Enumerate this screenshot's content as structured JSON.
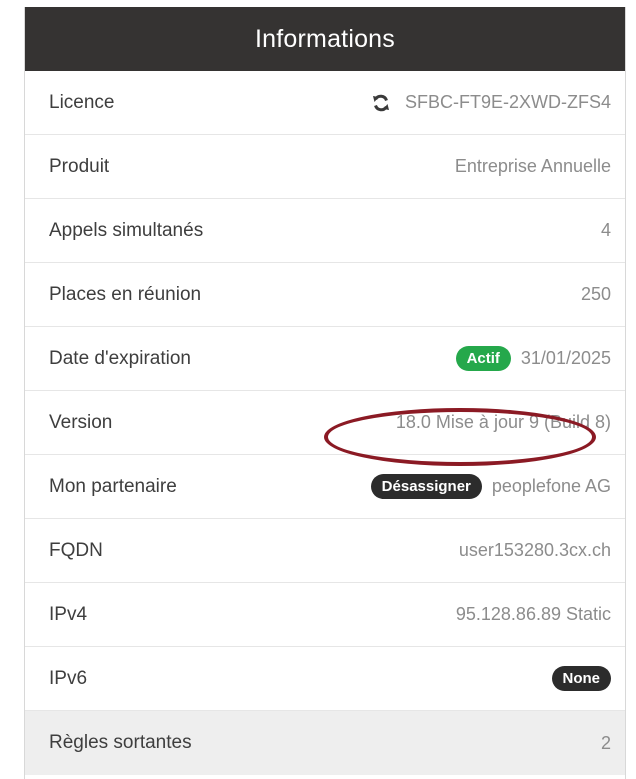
{
  "header": {
    "title": "Informations"
  },
  "rows": [
    {
      "label": "Licence",
      "value": "SFBC-FT9E-2XWD-ZFS4",
      "icon": "refresh-icon"
    },
    {
      "label": "Produit",
      "value": "Entreprise Annuelle"
    },
    {
      "label": "Appels simultanés",
      "value": "4"
    },
    {
      "label": "Places en réunion",
      "value": "250"
    },
    {
      "label": "Date d'expiration",
      "badge": "Actif",
      "value": "31/01/2025"
    },
    {
      "label": "Version",
      "value": "18.0 Mise à jour 9 (Build 8)"
    },
    {
      "label": "Mon partenaire",
      "badge": "Désassigner",
      "value": "peoplefone AG"
    },
    {
      "label": "FQDN",
      "value": "user153280.3cx.ch"
    },
    {
      "label": "IPv4",
      "value": "95.128.86.89 Static"
    },
    {
      "label": "IPv6",
      "badge": "None"
    },
    {
      "label": "Règles sortantes",
      "value": "2"
    }
  ],
  "colors": {
    "header_bg": "#353332",
    "active_badge": "#25a84b",
    "dark_badge": "#2c2c2c",
    "annotation": "#8b1a24"
  }
}
